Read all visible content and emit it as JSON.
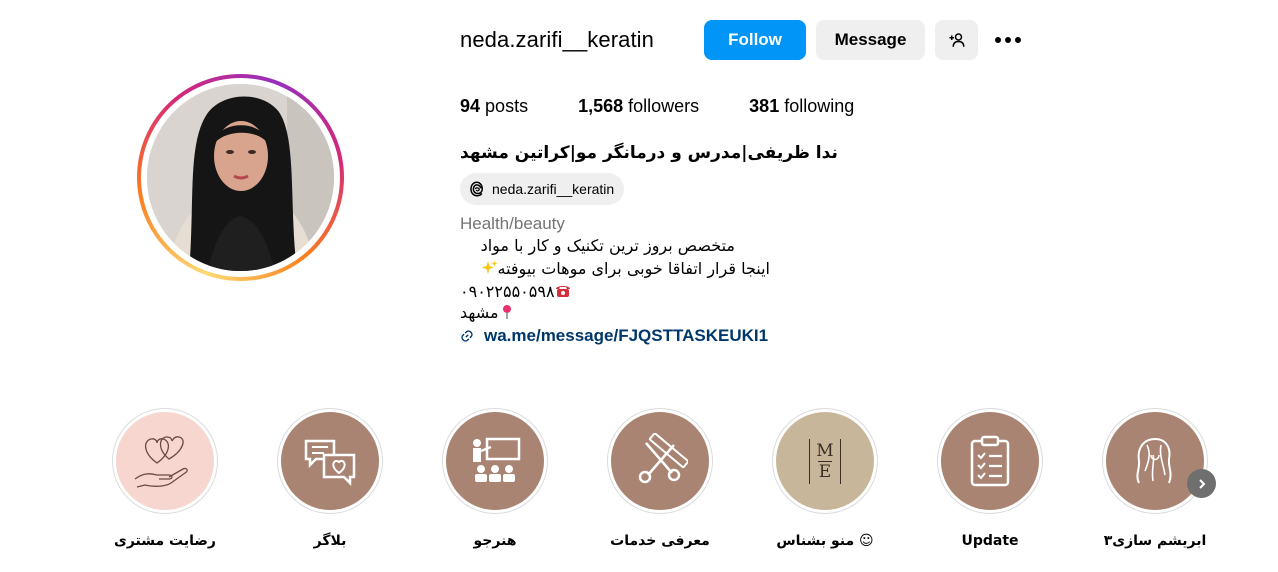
{
  "profile": {
    "username": "neda.zarifi__keratin",
    "full_name": "ندا ظریفی|مدرس و درمانگر مو|کراتین مشهد",
    "threads_handle": "neda.zarifi__keratin",
    "category": "Health/beauty",
    "bio_lines": [
      "متخصص بروز ترین تکنیک و کار با مواد",
      "اینجا قرار اتفاقا خوبی برای موهات بیوفته",
      "۰۹۰۲۲۵۵۰۵۹۸",
      "مشهد"
    ],
    "link": "wa.me/message/FJQSTTASKEUKI1"
  },
  "buttons": {
    "follow": "Follow",
    "message": "Message"
  },
  "stats": [
    {
      "value": "94",
      "label": "posts"
    },
    {
      "value": "1,568",
      "label": "followers"
    },
    {
      "value": "381",
      "label": "following"
    }
  ],
  "icons": {
    "add_user": "add-user-icon",
    "more": "more-options-icon",
    "threads": "threads-icon",
    "link": "link-icon",
    "next": "chevron-right-icon"
  },
  "colors": {
    "follow_bg": "#0095f6",
    "link_text": "#00376b",
    "highlight_brown": "#a98472"
  },
  "highlights": [
    {
      "label": "ابریشم سازی۳",
      "icon": "hair-icon"
    },
    {
      "label": "Update",
      "icon": "clipboard-icon"
    },
    {
      "label": "منو بشناس ☺",
      "icon": "me-logo-icon"
    },
    {
      "label": "معرفی خدمات",
      "icon": "scissors-comb-icon"
    },
    {
      "label": "هنرجو",
      "icon": "classroom-icon"
    },
    {
      "label": "بلاگر",
      "icon": "chat-heart-icon"
    },
    {
      "label": "رضایت مشتری",
      "icon": "hand-hearts-icon"
    }
  ],
  "me_logo": {
    "top": "M",
    "bottom": "E"
  }
}
